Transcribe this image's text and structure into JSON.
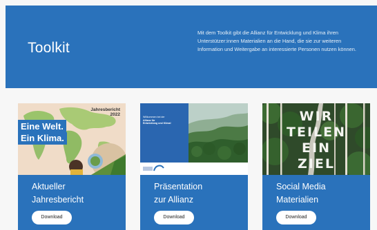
{
  "hero": {
    "title": "Toolkit",
    "description": "Mit dem Toolkit gibt die Allianz für Entwicklung und Klima ihren Unterstützer:innen Materialien an die Hand, die sie zur weiteren Information und Weitergabe an interessierte Personen nutzen können."
  },
  "cards": [
    {
      "title_line1": "Aktueller",
      "title_line2": "Jahresbericht",
      "button": "Download",
      "thumb": {
        "report_label": "Jahresbericht",
        "report_year": "2022",
        "slogan_line1": "Eine Welt.",
        "slogan_line2": "Ein Klima."
      }
    },
    {
      "title_line1": "Präsentation",
      "title_line2": "zur Allianz",
      "button": "Download",
      "thumb": {
        "welcome_line1": "Willkommen bei der",
        "welcome_line2": "Allianz für",
        "welcome_line3": "Entwicklung und Klima!"
      }
    },
    {
      "title_line1": "Social Media",
      "title_line2": "Materialien",
      "button": "Download",
      "thumb": {
        "word1": "WIR",
        "word2": "TEILEN",
        "word3": "EIN",
        "word4": "ZIEL"
      }
    }
  ],
  "colors": {
    "brand_blue": "#2a72bb",
    "background": "#f7f7f7",
    "button_bg": "#ffffff"
  }
}
